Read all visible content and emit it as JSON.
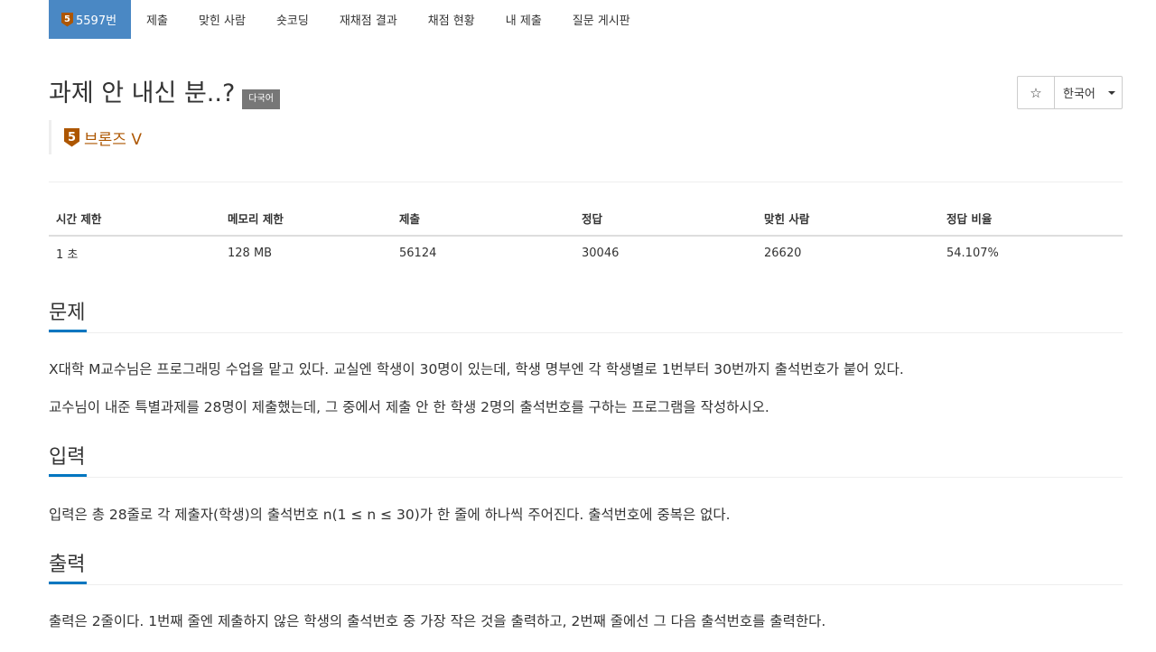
{
  "nav": {
    "problem_number": "5597번",
    "tier_number": "5",
    "items": [
      "제출",
      "맞힌 사람",
      "숏코딩",
      "재채점 결과",
      "채점 현황",
      "내 제출",
      "질문 게시판"
    ]
  },
  "problem": {
    "title": "과제 안 내신 분..?",
    "language_label": "다국어",
    "tier_number": "5",
    "tier_name": "브론즈 V",
    "tier_color": "#ad5600"
  },
  "controls": {
    "star_icon": "☆",
    "language": "한국어"
  },
  "stats": {
    "headers": [
      "시간 제한",
      "메모리 제한",
      "제출",
      "정답",
      "맞힌 사람",
      "정답 비율"
    ],
    "values": [
      "1 초",
      "128 MB",
      "56124",
      "30046",
      "26620",
      "54.107%"
    ]
  },
  "sections": {
    "problem_title": "문제",
    "problem_p1": "X대학 M교수님은 프로그래밍 수업을 맡고 있다. 교실엔 학생이 30명이 있는데, 학생 명부엔 각 학생별로 1번부터 30번까지 출석번호가 붙어 있다.",
    "problem_p2": "교수님이 내준 특별과제를 28명이 제출했는데, 그 중에서 제출 안 한 학생 2명의 출석번호를 구하는 프로그램을 작성하시오.",
    "input_title": "입력",
    "input_p1": "입력은 총 28줄로 각 제출자(학생)의 출석번호 n(1 ≤ n ≤ 30)가 한 줄에 하나씩 주어진다. 출석번호에 중복은 없다.",
    "output_title": "출력",
    "output_p1": "출력은 2줄이다. 1번째 줄엔 제출하지 않은 학생의 출석번호 중 가장 작은 것을 출력하고, 2번째 줄에선 그 다음 출석번호를 출력한다."
  },
  "colors": {
    "nav_active": "#4a88c4",
    "section_underline": "#0076c0"
  }
}
